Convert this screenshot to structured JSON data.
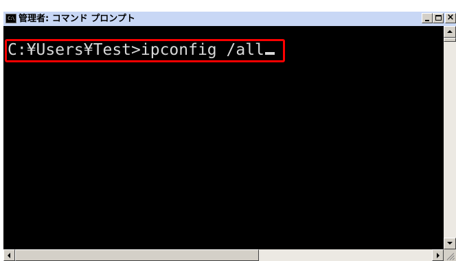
{
  "window": {
    "title": "管理者: コマンド プロンプト",
    "icon_text": "C:\\",
    "icon": "console-icon"
  },
  "title_buttons": {
    "minimize_icon": "minimize-icon",
    "maximize_icon": "maximize-icon",
    "close_label": "×"
  },
  "console": {
    "background": "#000000",
    "text_color": "#d8d8d8",
    "prompt": "C:¥Users¥Test>",
    "command": "ipconfig /all",
    "highlight_color": "#ff0000"
  },
  "scrollbars": {
    "vertical": [
      "scroll-up",
      "scroll-down"
    ],
    "horizontal": [
      "scroll-left",
      "scroll-right"
    ]
  }
}
